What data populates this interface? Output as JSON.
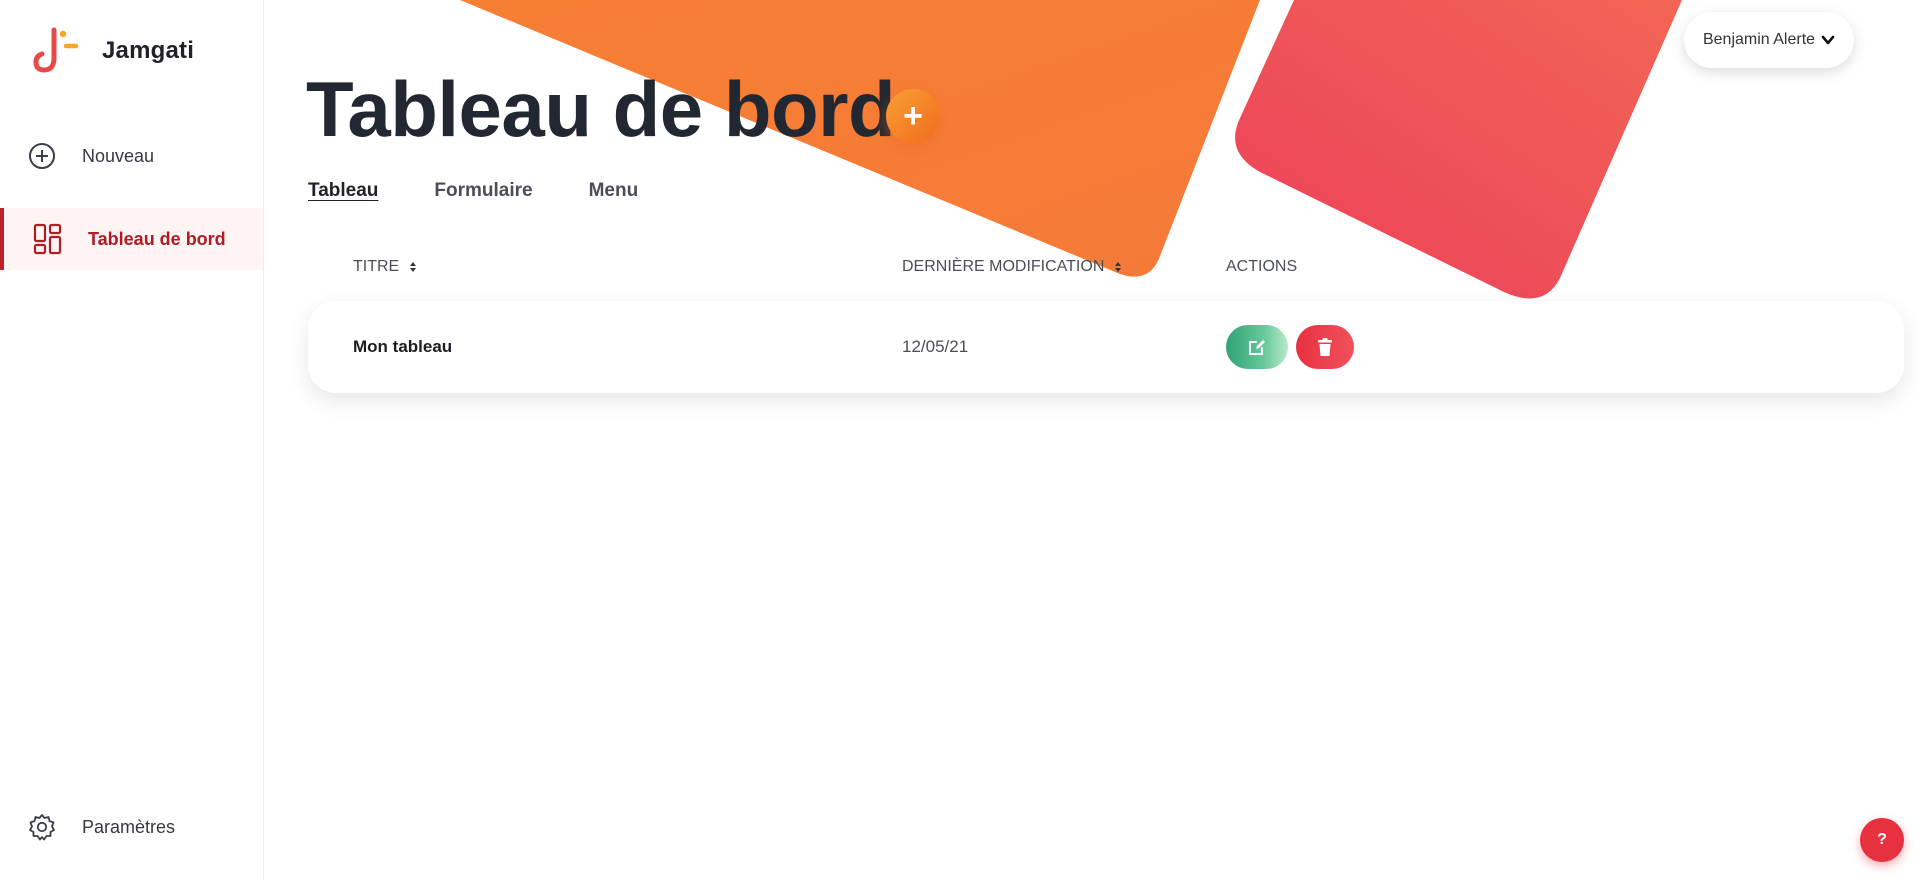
{
  "app": {
    "name": "Jamgati"
  },
  "sidebar": {
    "items": [
      {
        "label": "Nouveau",
        "icon": "plus-circle-icon"
      },
      {
        "label": "Tableau de bord",
        "icon": "dashboard-icon",
        "active": true
      },
      {
        "label": "Paramètres",
        "icon": "gear-icon"
      }
    ]
  },
  "header": {
    "title": "Tableau de bord",
    "add_label": "+",
    "user_name": "Benjamin Alerte"
  },
  "tabs": [
    {
      "label": "Tableau",
      "active": true
    },
    {
      "label": "Formulaire"
    },
    {
      "label": "Menu"
    }
  ],
  "table": {
    "columns": [
      "TITRE",
      "DERNIÈRE MODIFICATION",
      "ACTIONS"
    ],
    "rows": [
      {
        "title": "Mon tableau",
        "modified": "12/05/21"
      }
    ]
  },
  "help": {
    "label": "?"
  },
  "colors": {
    "accent_orange": "#f47b2f",
    "accent_red": "#e8313f",
    "active_nav": "#b01c25",
    "edit_green": "#2fa375"
  }
}
